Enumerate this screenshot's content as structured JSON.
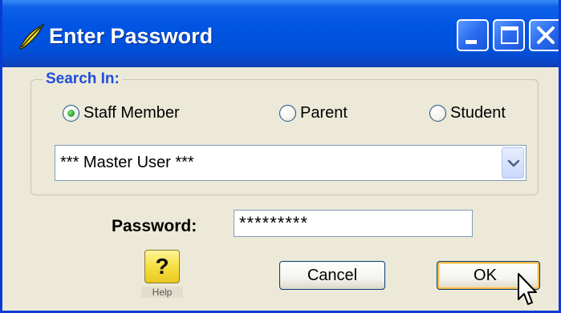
{
  "window": {
    "title": "Enter Password",
    "app_icon": "leaf-logo-icon",
    "controls": [
      "minimize-icon",
      "maximize-icon",
      "close-icon"
    ]
  },
  "search_group": {
    "legend": "Search In:",
    "options": [
      {
        "label": "Staff Member",
        "selected": true
      },
      {
        "label": "Parent",
        "selected": false
      },
      {
        "label": "Student",
        "selected": false
      }
    ],
    "user_select": {
      "value": "*** Master User ***"
    }
  },
  "password": {
    "label": "Password:",
    "value": "*********"
  },
  "buttons": {
    "help_label": "Help",
    "help_glyph": "?",
    "cancel_label": "Cancel",
    "ok_label": "OK"
  },
  "colors": {
    "title_bar": "#0054E3",
    "dialog_bg": "#ECE9D8",
    "legend_text": "#1E4ED8",
    "radio_selected": "#2FA82F",
    "help_button": "#F7E247",
    "ok_focus": "#F8B84A"
  }
}
